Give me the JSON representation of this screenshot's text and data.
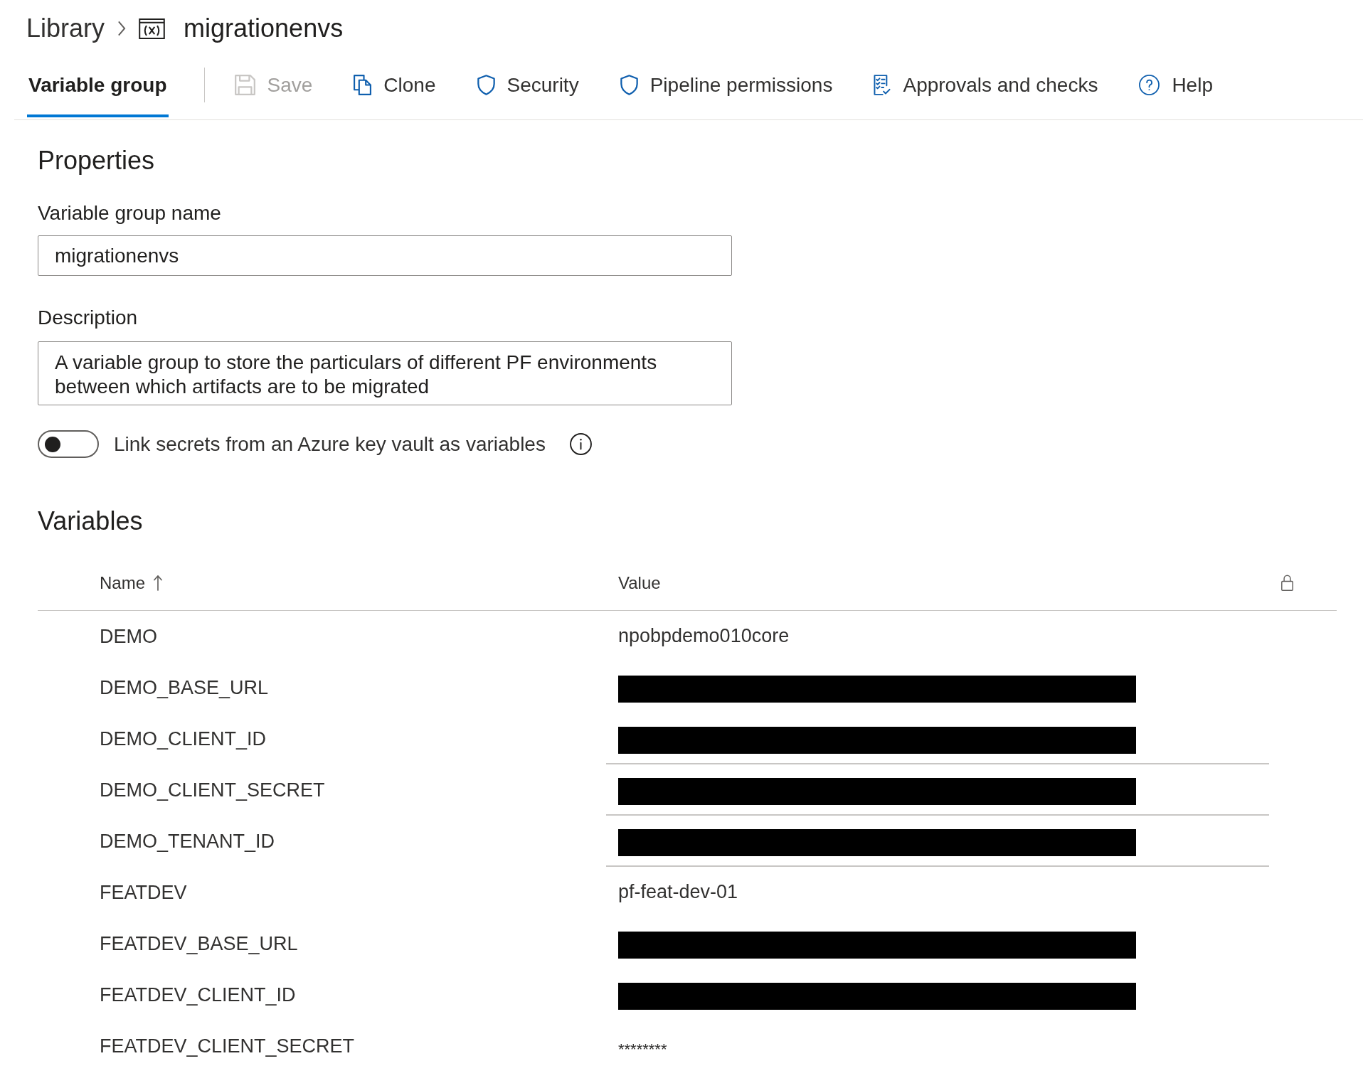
{
  "breadcrumb": [
    {
      "label": "Library",
      "kind": "link"
    },
    {
      "label": "migrationenvs",
      "kind": "current"
    }
  ],
  "tabs": [
    {
      "label": "Variable group",
      "selected": true
    }
  ],
  "toolbar": [
    {
      "label": "Save",
      "disabled": true
    },
    {
      "label": "Clone",
      "disabled": false
    },
    {
      "label": "Security",
      "disabled": false
    },
    {
      "label": "Pipeline permissions",
      "disabled": false
    },
    {
      "label": "Approvals and checks",
      "disabled": false
    },
    {
      "label": "Help",
      "disabled": false
    }
  ],
  "properties": {
    "title": "Properties",
    "name_field": {
      "label": "Variable group name",
      "value": "migrationenvs"
    },
    "description_field": {
      "label": "Description",
      "value": "A variable group to store the particulars of different PF environments between which artifacts are to be migrated"
    },
    "key_vault_toggle": {
      "label": "Link secrets from an Azure key vault as variables",
      "on": false
    }
  },
  "variables": {
    "title": "Variables",
    "columns": [
      {
        "label": "Name",
        "sorted_ascending": true
      },
      {
        "label": "Value",
        "sorted_ascending": false
      }
    ],
    "rows": [
      {
        "name": "DEMO",
        "kind": "text",
        "value": "npobpdemo010core",
        "divider_below": false
      },
      {
        "name": "DEMO_BASE_URL",
        "kind": "redacted",
        "divider_below": false
      },
      {
        "name": "DEMO_CLIENT_ID",
        "kind": "redacted",
        "divider_below": true
      },
      {
        "name": "DEMO_CLIENT_SECRET",
        "kind": "redacted",
        "divider_below": true
      },
      {
        "name": "DEMO_TENANT_ID",
        "kind": "redacted",
        "divider_below": true
      },
      {
        "name": "FEATDEV",
        "kind": "text",
        "value": "pf-feat-dev-01",
        "divider_below": false
      },
      {
        "name": "FEATDEV_BASE_URL",
        "kind": "redacted",
        "divider_below": false
      },
      {
        "name": "FEATDEV_CLIENT_ID",
        "kind": "redacted",
        "divider_below": false
      },
      {
        "name": "FEATDEV_CLIENT_SECRET",
        "kind": "secret",
        "value": "********",
        "divider_below": false
      }
    ]
  }
}
